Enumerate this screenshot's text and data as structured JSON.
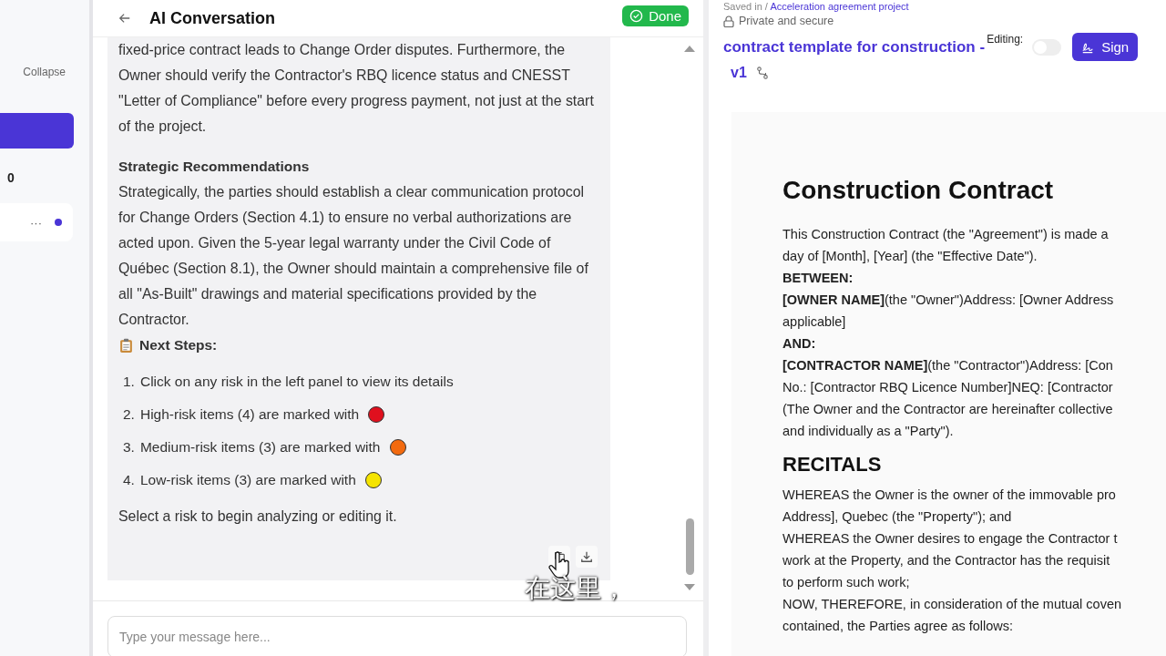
{
  "sidebar": {
    "collapse_label": "Collapse",
    "count": "0",
    "more_label": "···"
  },
  "chat": {
    "title": "AI Conversation",
    "done_label": "Done",
    "paragraphs_top": [
      "fixed-price contract leads to Change Order disputes. Furthermore, the Owner should verify the Contractor's RBQ licence status and CNESST \"Letter of Compliance\" before every progress payment, not just at the start of the project."
    ],
    "section_heading": "Strategic Recommendations",
    "section_text": "Strategically, the parties should establish a clear communication protocol for Change Orders (Section 4.1) to ensure no verbal authorizations are acted upon. Given the 5-year legal warranty under the Civil Code of Québec (Section 8.1), the Owner should maintain a comprehensive file of all \"As-Built\" drawings and material specifications provided by the Contractor.",
    "next_steps_heading": "Next Steps:",
    "steps": [
      {
        "number": "1.",
        "text": "Click on any risk in the left panel to view its details"
      },
      {
        "number": "2.",
        "text": "High-risk items (4) are marked with",
        "color": "#e0101e"
      },
      {
        "number": "3.",
        "text": "Medium-risk items (3) are marked with",
        "color": "#f26a0f"
      },
      {
        "number": "4.",
        "text": "Low-risk items (3) are marked with",
        "color": "#f5e400"
      }
    ],
    "closing": "Select a risk to begin analyzing or editing it.",
    "input_placeholder": "Type your message here..."
  },
  "subtitle": "在这里，",
  "document": {
    "saved_prefix": "Saved in /",
    "project_link": "Acceleration agreement project",
    "privacy": "Private and secure",
    "title": "contract template for construction -",
    "editing_label": "Editing:",
    "editing_on": false,
    "sign_label": "Sign",
    "version": "v1",
    "heading": "Construction Contract",
    "lines": [
      {
        "kind": "text",
        "text": "This Construction Contract (the \"Agreement\") is made a"
      },
      {
        "kind": "text",
        "text": "day of [Month], [Year] (the \"Effective Date\")."
      },
      {
        "kind": "bold",
        "text": "BETWEEN:"
      },
      {
        "kind": "text",
        "text": "**[OWNER NAME]**(the \"Owner\")Address: [Owner Address"
      },
      {
        "kind": "text",
        "text": "applicable]"
      },
      {
        "kind": "bold",
        "text": "AND:"
      },
      {
        "kind": "text",
        "text": "**[CONTRACTOR NAME]**(the \"Contractor\")Address: [Con"
      },
      {
        "kind": "text",
        "text": "No.: [Contractor RBQ Licence Number]NEQ: [Contractor"
      },
      {
        "kind": "text",
        "text": "(The Owner and the Contractor are hereinafter collective"
      },
      {
        "kind": "text",
        "text": "and individually as a \"Party\")."
      },
      {
        "kind": "heading",
        "text": "RECITALS"
      },
      {
        "kind": "text",
        "text": "WHEREAS the Owner is the owner of the immovable pro"
      },
      {
        "kind": "text",
        "text": "Address], Quebec (the \"Property\"); and"
      },
      {
        "kind": "text",
        "text": "WHEREAS the Owner desires to engage the Contractor t"
      },
      {
        "kind": "text",
        "text": "work at the Property, and the Contractor has the requisit"
      },
      {
        "kind": "text",
        "text": "to perform such work;"
      },
      {
        "kind": "text",
        "text": "NOW, THEREFORE, in consideration of the mutual coven"
      },
      {
        "kind": "text",
        "text": "contained, the Parties agree as follows:"
      }
    ]
  }
}
